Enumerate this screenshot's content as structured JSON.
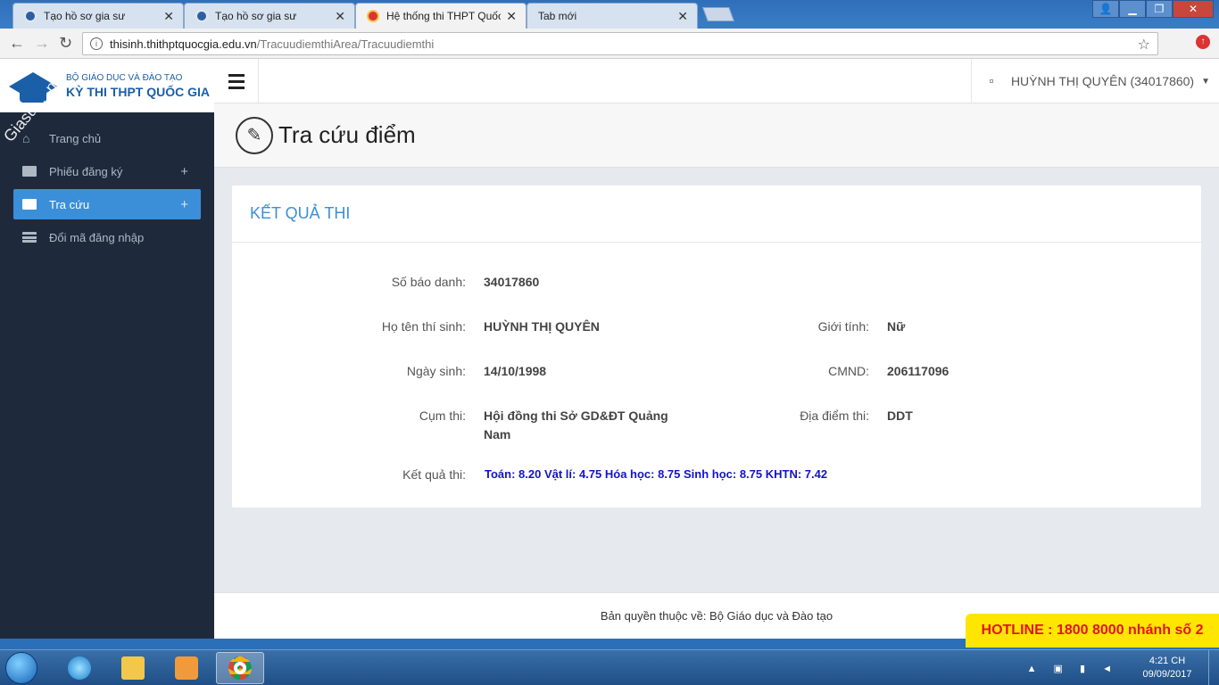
{
  "browser": {
    "tabs": [
      {
        "title": "Tạo hồ sơ gia sư",
        "favicon": "site-icon"
      },
      {
        "title": "Tạo hồ sơ gia sư",
        "favicon": "site-icon"
      },
      {
        "title": "Hệ thống thi THPT Quốc",
        "favicon": "emblem-icon",
        "active": true
      },
      {
        "title": "Tab mới"
      }
    ],
    "url_host": "thisinh.thithptquocgia.edu.vn",
    "url_path": "/TracuudiemthiArea/Tracuudiemthi"
  },
  "brand": {
    "line1": "BỘ GIÁO DỤC VÀ ĐÀO TẠO",
    "line2": "KỲ THI THPT QUỐC GIA",
    "watermark": "Giasu... .net"
  },
  "sidebar": {
    "items": [
      {
        "label": "Trang chủ",
        "icon": "home-icon"
      },
      {
        "label": "Phiếu đăng ký",
        "icon": "folder-icon",
        "expand": "+"
      },
      {
        "label": "Tra cứu",
        "icon": "folder-icon",
        "expand": "+",
        "active": true
      },
      {
        "label": "Đổi mã đăng nhập",
        "icon": "list-icon"
      }
    ]
  },
  "topbar": {
    "user": "HUỲNH THỊ QUYÊN (34017860)"
  },
  "page": {
    "title": "Tra cứu điểm"
  },
  "card": {
    "heading": "KẾT QUẢ THI",
    "fields": {
      "sbd_label": "Số báo danh:",
      "sbd": "34017860",
      "name_label": "Họ tên thí sinh:",
      "name": "HUỲNH THỊ QUYÊN",
      "gender_label": "Giới tính:",
      "gender": "Nữ",
      "dob_label": "Ngày sinh:",
      "dob": "14/10/1998",
      "cmnd_label": "CMND:",
      "cmnd": "206117096",
      "cluster_label": "Cụm thi:",
      "cluster_line1": "Hội đồng thi Sở GD&ĐT Quảng",
      "cluster_line2": "Nam",
      "site_label": "Địa điểm thi:",
      "site": "DDT",
      "result_label": "Kết quả thi:",
      "result": "Toán: 8.20 Vật lí: 4.75 Hóa học: 8.75 Sinh học: 8.75 KHTN: 7.42"
    }
  },
  "footer": {
    "text": "Bản quyền thuộc về: Bộ Giáo dục và Đào tạo",
    "hotline": "HOTLINE : 1800 8000 nhánh số 2"
  },
  "taskbar": {
    "time": "4:21 CH",
    "date": "09/09/2017"
  },
  "colors": {
    "accent": "#3b8fd9",
    "sidebar_bg": "#1e2a3b",
    "result_text": "#1414c8",
    "hotline_bg": "#ffe600",
    "hotline_text": "#e0161b"
  }
}
